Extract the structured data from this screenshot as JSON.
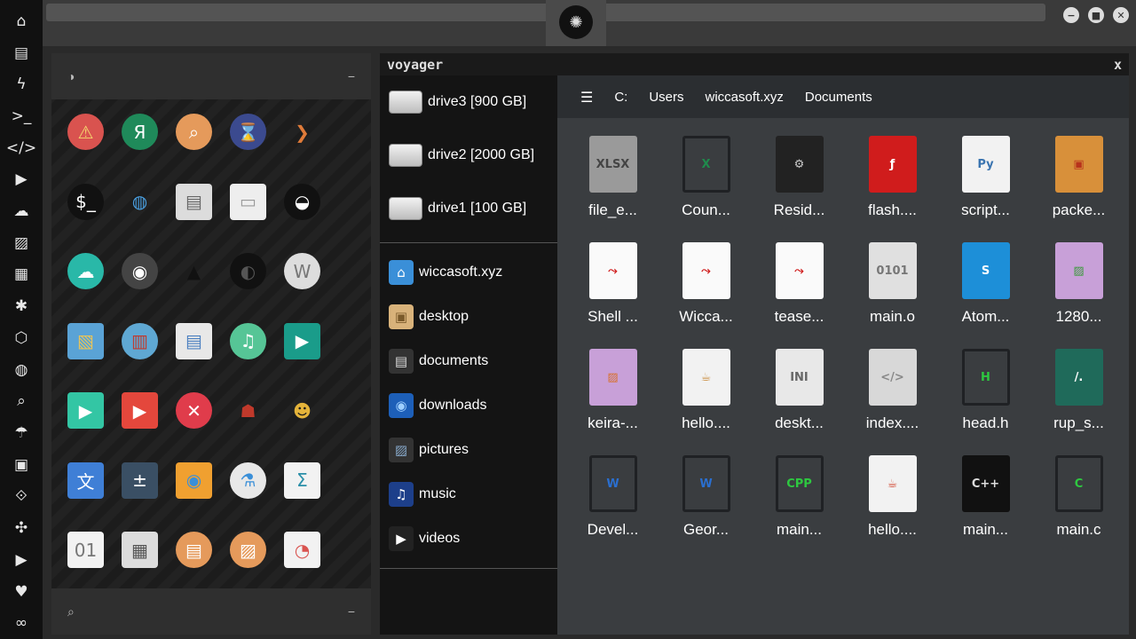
{
  "dock": {
    "items": [
      {
        "icon": "home-icon",
        "glyph": "⌂"
      },
      {
        "icon": "document-icon",
        "glyph": "▤"
      },
      {
        "icon": "lightning-icon",
        "glyph": "ϟ"
      },
      {
        "icon": "terminal-icon",
        "glyph": ">_"
      },
      {
        "icon": "code-icon",
        "glyph": "</>"
      },
      {
        "icon": "play-icon",
        "glyph": "▶"
      },
      {
        "icon": "cloud-icon",
        "glyph": "☁"
      },
      {
        "icon": "image-icon",
        "glyph": "▨"
      },
      {
        "icon": "news-icon",
        "glyph": "▦"
      },
      {
        "icon": "star-badge-icon",
        "glyph": "✱"
      },
      {
        "icon": "hexagon-icon",
        "glyph": "⬡"
      },
      {
        "icon": "globe-icon",
        "glyph": "◍"
      },
      {
        "icon": "search-icon",
        "glyph": "⌕"
      },
      {
        "icon": "umbrella-icon",
        "glyph": "☂"
      },
      {
        "icon": "contact-icon",
        "glyph": "▣"
      },
      {
        "icon": "link-icon",
        "glyph": "⟐"
      },
      {
        "icon": "expand-icon",
        "glyph": "✣"
      },
      {
        "icon": "youtube-icon",
        "glyph": "▶"
      },
      {
        "icon": "heart-icon",
        "glyph": "♥"
      },
      {
        "icon": "infinity-cloud-icon",
        "glyph": "∞"
      }
    ]
  },
  "topbar": {
    "logo_glyph": "✺"
  },
  "window_controls": {
    "minimize": "−",
    "maximize": "■",
    "close": "✕"
  },
  "left_panel": {
    "head_glyph": "◑",
    "head_collapse": "−",
    "foot_glyph": "⌕",
    "foot_collapse": "−",
    "apps": [
      {
        "icon": "warning-icon",
        "glyph": "⚠",
        "bg": "#d9534f",
        "fg": "#f5d76e",
        "shape": "circle"
      },
      {
        "icon": "yandex-icon",
        "glyph": "Я",
        "bg": "#1f8a5a",
        "fg": "#fff",
        "shape": "circle"
      },
      {
        "icon": "magnifier-icon",
        "glyph": "⌕",
        "bg": "#e59a5b",
        "fg": "#fff",
        "shape": "circle"
      },
      {
        "icon": "hourglass-icon",
        "glyph": "⌛",
        "bg": "#3b4a8f",
        "fg": "#f2c14e",
        "shape": "circle"
      },
      {
        "icon": "arrow-right-icon",
        "glyph": "❯",
        "bg": "transparent",
        "fg": "#e07b39",
        "shape": "plain"
      },
      {
        "icon": "terminal-circle-icon",
        "glyph": "$_",
        "bg": "#111",
        "fg": "#fff",
        "shape": "circle"
      },
      {
        "icon": "web-browser-icon",
        "glyph": "◍",
        "bg": "transparent",
        "fg": "#4a9fe0",
        "shape": "plain"
      },
      {
        "icon": "scanner-icon",
        "glyph": "▤",
        "bg": "#dcdcdc",
        "fg": "#666",
        "shape": "square"
      },
      {
        "icon": "window-icon",
        "glyph": "▭",
        "bg": "#eeeeee",
        "fg": "#999",
        "shape": "square"
      },
      {
        "icon": "bed-icon",
        "glyph": "◒",
        "bg": "#111",
        "fg": "#fff",
        "shape": "circle"
      },
      {
        "icon": "cloud-lock-icon",
        "glyph": "☁",
        "bg": "#29b8a8",
        "fg": "#fff",
        "shape": "circle"
      },
      {
        "icon": "github-icon",
        "glyph": "◉",
        "bg": "#444",
        "fg": "#fff",
        "shape": "circle"
      },
      {
        "icon": "starfleet-icon",
        "glyph": "▲",
        "bg": "transparent",
        "fg": "#111",
        "shape": "plain"
      },
      {
        "icon": "death-star-icon",
        "glyph": "◐",
        "bg": "#111",
        "fg": "#555",
        "shape": "circle"
      },
      {
        "icon": "wikipedia-icon",
        "glyph": "W",
        "bg": "#ddd",
        "fg": "#777",
        "shape": "circle"
      },
      {
        "icon": "world-map-icon",
        "glyph": "▧",
        "bg": "#5aa3d6",
        "fg": "#e8c45a",
        "shape": "square"
      },
      {
        "icon": "books-icon",
        "glyph": "▥",
        "bg": "#5fa8d3",
        "fg": "#c0392b",
        "shape": "circle"
      },
      {
        "icon": "archive-file-icon",
        "glyph": "▤",
        "bg": "#e8e8e8",
        "fg": "#4a7fc0",
        "shape": "square"
      },
      {
        "icon": "music-note-icon",
        "glyph": "♫",
        "bg": "#56c596",
        "fg": "#fff",
        "shape": "circle"
      },
      {
        "icon": "film-icon",
        "glyph": "▶",
        "bg": "#1a9c8a",
        "fg": "#fff",
        "shape": "square"
      },
      {
        "icon": "media-player-icon",
        "glyph": "▶",
        "bg": "#33c6a4",
        "fg": "#fff",
        "shape": "square"
      },
      {
        "icon": "video-icon",
        "glyph": "▶",
        "bg": "#e4473c",
        "fg": "#fff",
        "shape": "square"
      },
      {
        "icon": "close-circle-icon",
        "glyph": "✕",
        "bg": "#e03c4b",
        "fg": "#fff",
        "shape": "circle"
      },
      {
        "icon": "iron-man-icon",
        "glyph": "☗",
        "bg": "transparent",
        "fg": "#c0392b",
        "shape": "plain"
      },
      {
        "icon": "c3po-icon",
        "glyph": "☻",
        "bg": "transparent",
        "fg": "#e4b33a",
        "shape": "plain"
      },
      {
        "icon": "translate-icon",
        "glyph": "文",
        "bg": "#3f7fd6",
        "fg": "#fff",
        "shape": "square"
      },
      {
        "icon": "calculator-icon",
        "glyph": "±",
        "bg": "#3a4f64",
        "fg": "#fff",
        "shape": "square"
      },
      {
        "icon": "photo-viewer-icon",
        "glyph": "◉",
        "bg": "#f0a030",
        "fg": "#3a8fd8",
        "shape": "square"
      },
      {
        "icon": "flask-icon",
        "glyph": "⚗",
        "bg": "#e8e8e8",
        "fg": "#3a8fd8",
        "shape": "circle"
      },
      {
        "icon": "math-doc-icon",
        "glyph": "Σ",
        "bg": "#f2f2f2",
        "fg": "#2a8fa8",
        "shape": "square"
      },
      {
        "icon": "binary-file-icon",
        "glyph": "01",
        "bg": "#f2f2f2",
        "fg": "#777",
        "shape": "square"
      },
      {
        "icon": "keyboard-icon",
        "glyph": "▦",
        "bg": "#dcdcdc",
        "fg": "#555",
        "shape": "square"
      },
      {
        "icon": "text-file-icon",
        "glyph": "▤",
        "bg": "#e59a5b",
        "fg": "#fff",
        "shape": "circle"
      },
      {
        "icon": "picture-icon",
        "glyph": "▨",
        "bg": "#e59a5b",
        "fg": "#fff",
        "shape": "circle"
      },
      {
        "icon": "presentation-icon",
        "glyph": "◔",
        "bg": "#f2f2f2",
        "fg": "#d9534f",
        "shape": "square"
      }
    ]
  },
  "voyager": {
    "title": "voyager",
    "close_label": "x",
    "drives": [
      {
        "label": "drive3 [900 GB]"
      },
      {
        "label": "drive2 [2000 GB]"
      },
      {
        "label": "drive1 [100 GB]"
      }
    ],
    "places": [
      {
        "label": "wiccasoft.xyz",
        "icon": "home-folder-icon",
        "glyph": "⌂",
        "bg": "#3a8fd8",
        "fg": "#fff"
      },
      {
        "label": "desktop",
        "icon": "desktop-box-icon",
        "glyph": "▣",
        "bg": "#d8b27a",
        "fg": "#7a5a2a"
      },
      {
        "label": "documents",
        "icon": "documents-folder-icon",
        "glyph": "▤",
        "bg": "#333",
        "fg": "#ddd"
      },
      {
        "label": "downloads",
        "icon": "downloads-icon",
        "glyph": "◉",
        "bg": "#1d5fb8",
        "fg": "#9fd0ff"
      },
      {
        "label": "pictures",
        "icon": "pictures-icon",
        "glyph": "▨",
        "bg": "#333",
        "fg": "#8ac"
      },
      {
        "label": "music",
        "icon": "music-folder-icon",
        "glyph": "♫",
        "bg": "#1d3f8a",
        "fg": "#fff"
      },
      {
        "label": "videos",
        "icon": "videos-icon",
        "glyph": "▶",
        "bg": "#222",
        "fg": "#fff"
      }
    ],
    "breadcrumb": {
      "menu_glyph": "☰",
      "items": [
        "C:",
        "Users",
        "wiccasoft.xyz",
        "Documents"
      ]
    },
    "files": [
      {
        "name": "file_e...",
        "icon": "xlsx-file-icon",
        "glyph": "XLSX",
        "bg": "#9a9a9a",
        "fg": "#444"
      },
      {
        "name": "Coun...",
        "icon": "excel-file-icon",
        "glyph": "X",
        "bg": "#3a3d40",
        "fg": "#1f8a4c"
      },
      {
        "name": "Resid...",
        "icon": "torrent-file-icon",
        "glyph": "⚙",
        "bg": "#222",
        "fg": "#ccc"
      },
      {
        "name": "flash....",
        "icon": "swf-file-icon",
        "glyph": "ƒ",
        "bg": "#d01c1c",
        "fg": "#fff"
      },
      {
        "name": "script...",
        "icon": "python-file-icon",
        "glyph": "Py",
        "bg": "#f2f2f2",
        "fg": "#3a74b0"
      },
      {
        "name": "packe...",
        "icon": "package-icon",
        "glyph": "▣",
        "bg": "#d8903a",
        "fg": "#b8321c"
      },
      {
        "name": "Shell ...",
        "icon": "pdf-file-icon",
        "glyph": "⤳",
        "bg": "#fafafa",
        "fg": "#d01c1c"
      },
      {
        "name": "Wicca...",
        "icon": "pdf-file-icon",
        "glyph": "⤳",
        "bg": "#fafafa",
        "fg": "#d01c1c"
      },
      {
        "name": "tease...",
        "icon": "pdf-file-icon",
        "glyph": "⤳",
        "bg": "#fafafa",
        "fg": "#d01c1c"
      },
      {
        "name": "main.o",
        "icon": "object-file-icon",
        "glyph": "0101",
        "bg": "#e0e0e0",
        "fg": "#777"
      },
      {
        "name": "Atom...",
        "icon": "atom-3d-icon",
        "glyph": "S",
        "bg": "#1d8fd8",
        "fg": "#fff"
      },
      {
        "name": "1280...",
        "icon": "image-file-icon",
        "glyph": "▨",
        "bg": "#c8a0d8",
        "fg": "#3a9a3a"
      },
      {
        "name": "keira-...",
        "icon": "image-file-icon",
        "glyph": "▨",
        "bg": "#c8a0d8",
        "fg": "#d8702a"
      },
      {
        "name": "hello....",
        "icon": "java-file-icon",
        "glyph": "☕",
        "bg": "#f2f2f2",
        "fg": "#c98a3a"
      },
      {
        "name": "deskt...",
        "icon": "ini-file-icon",
        "glyph": "INI",
        "bg": "#e8e8e8",
        "fg": "#666"
      },
      {
        "name": "index....",
        "icon": "html-file-icon",
        "glyph": "</>",
        "bg": "#d8d8d8",
        "fg": "#888"
      },
      {
        "name": "head.h",
        "icon": "header-file-icon",
        "glyph": "H",
        "bg": "#3a3d40",
        "fg": "#2ec840"
      },
      {
        "name": "rup_s...",
        "icon": "slash-app-icon",
        "glyph": "/.",
        "bg": "#1f6a5a",
        "fg": "#fff"
      },
      {
        "name": "Devel...",
        "icon": "word-file-icon",
        "glyph": "W",
        "bg": "#3a3d40",
        "fg": "#2a6fd0"
      },
      {
        "name": "Geor...",
        "icon": "word-file-icon",
        "glyph": "W",
        "bg": "#3a3d40",
        "fg": "#2a6fd0"
      },
      {
        "name": "main...",
        "icon": "cpp-file-icon",
        "glyph": "CPP",
        "bg": "#3a3d40",
        "fg": "#2ec840"
      },
      {
        "name": "hello....",
        "icon": "java-class-icon",
        "glyph": "☕",
        "bg": "#f2f2f2",
        "fg": "#d0402a"
      },
      {
        "name": "main...",
        "icon": "cplusplus-file-icon",
        "glyph": "C++",
        "bg": "#111",
        "fg": "#ddd"
      },
      {
        "name": "main.c",
        "icon": "c-file-icon",
        "glyph": "C",
        "bg": "#3a3d40",
        "fg": "#2ec840"
      }
    ]
  }
}
